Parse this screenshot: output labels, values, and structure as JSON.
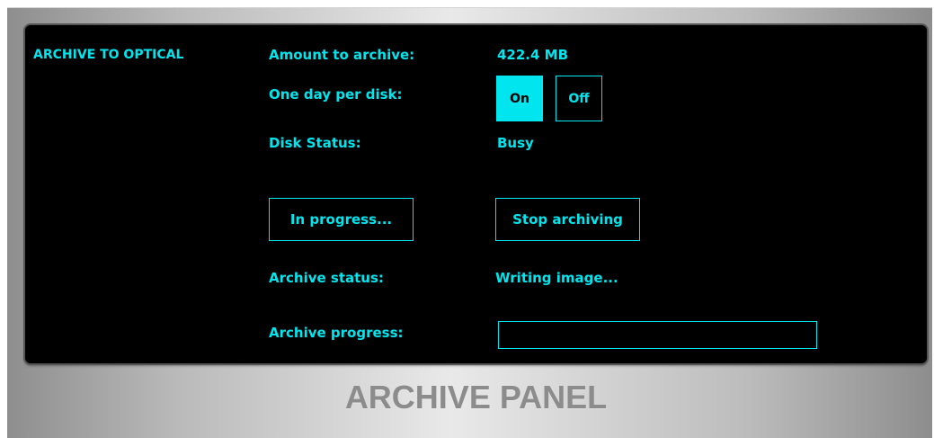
{
  "section_title": "ARCHIVE TO OPTICAL",
  "amount": {
    "label": "Amount to archive:",
    "value": "422.4 MB"
  },
  "one_day_per_disk": {
    "label": "One day per disk:",
    "on_label": "On",
    "off_label": "Off",
    "selected": "On"
  },
  "disk_status": {
    "label": "Disk Status:",
    "value": "Busy"
  },
  "buttons": {
    "in_progress": "In progress...",
    "stop": "Stop archiving"
  },
  "archive_status": {
    "label": "Archive status:",
    "value": "Writing image..."
  },
  "archive_progress": {
    "label": "Archive progress:",
    "fraction": 0
  },
  "panel_title": "ARCHIVE PANEL",
  "colors": {
    "accent": "#00e5ee",
    "screen_bg": "#000000",
    "bezel_text": "#8c8c8c"
  }
}
